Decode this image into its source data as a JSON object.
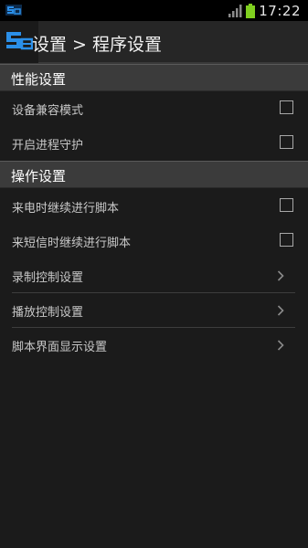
{
  "status_bar": {
    "time": "17:22",
    "icons": [
      "app-notification-icon",
      "signal-icon",
      "battery-icon"
    ],
    "battery_color": "#7fcf1f"
  },
  "action_bar": {
    "title": "设置 > 程序设置",
    "logo_icon": "app-logo-icon",
    "logo_color": "#2b8fe8"
  },
  "sections": [
    {
      "header": "性能设置",
      "items": [
        {
          "label": "设备兼容模式",
          "control": "checkbox",
          "checked": false
        },
        {
          "label": "开启进程守护",
          "control": "checkbox",
          "checked": false
        }
      ]
    },
    {
      "header": "操作设置",
      "items": [
        {
          "label": "来电时继续进行脚本",
          "control": "checkbox",
          "checked": false
        },
        {
          "label": "来短信时继续进行脚本",
          "control": "checkbox",
          "checked": false
        },
        {
          "label": "录制控制设置",
          "control": "chevron-right-icon"
        },
        {
          "label": "播放控制设置",
          "control": "chevron-right-icon"
        },
        {
          "label": "脚本界面显示设置",
          "control": "chevron-right-icon"
        }
      ]
    }
  ]
}
